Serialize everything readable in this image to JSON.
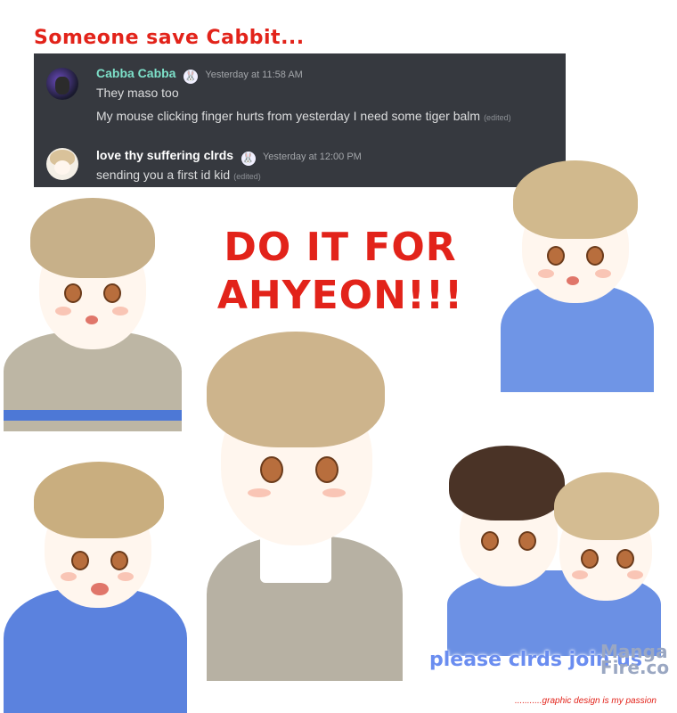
{
  "caption": "Someone save Cabbit...",
  "chat": {
    "messages": [
      {
        "username": "Cabba Cabba",
        "username_color": "#7de0c9",
        "badge_icon": "bunny-icon",
        "timestamp": "Yesterday at 11:58 AM",
        "lines": [
          "They maso too",
          "My mouse clicking finger hurts from yesterday I need some tiger balm"
        ],
        "edited_label": "(edited)"
      },
      {
        "username": "love thy suffering clrds",
        "username_color": "#ffffff",
        "badge_icon": "bunny-icon",
        "timestamp": "Yesterday at 12:00 PM",
        "lines": [
          "sending you a first id kid"
        ],
        "edited_label": "(edited)"
      }
    ],
    "background": "#36393f"
  },
  "headline": {
    "line1": "DO IT FOR",
    "line2": "AHYEON!!!",
    "color": "#e2231a"
  },
  "watermark": {
    "text": "please clrds join us",
    "logo_line1": "Manga",
    "logo_line2": "Fire.co"
  },
  "bottom_note": "...........graphic design is my passion"
}
